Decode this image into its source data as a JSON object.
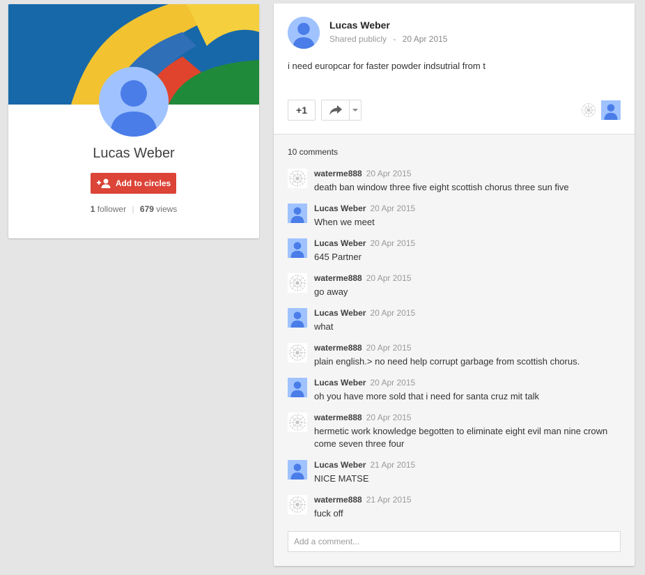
{
  "profile": {
    "name": "Lucas Weber",
    "add_button_label": "Add to circles",
    "followers_count": "1",
    "followers_label": "follower",
    "views_count": "679",
    "views_label": "views"
  },
  "post": {
    "author": "Lucas Weber",
    "visibility": "Shared publicly",
    "date": "20 Apr 2015",
    "text": "i need europcar for faster powder indsutrial from t",
    "plus_one_label": "+1",
    "comments_count_label": "10 comments",
    "add_comment_placeholder": "Add a comment..."
  },
  "comments": [
    {
      "author": "waterme888",
      "date": "20 Apr 2015",
      "text": "death ban window three five eight scottish chorus three sun five",
      "avatar": "pattern"
    },
    {
      "author": "Lucas Weber",
      "date": "20 Apr 2015",
      "text": "When we meet",
      "avatar": "user"
    },
    {
      "author": "Lucas Weber",
      "date": "20 Apr 2015",
      "text": "645 Partner",
      "avatar": "user"
    },
    {
      "author": "waterme888",
      "date": "20 Apr 2015",
      "text": "go away",
      "avatar": "pattern"
    },
    {
      "author": "Lucas Weber",
      "date": "20 Apr 2015",
      "text": "what",
      "avatar": "user"
    },
    {
      "author": "waterme888",
      "date": "20 Apr 2015",
      "text": "plain english.> no need help corrupt garbage from scottish chorus.",
      "avatar": "pattern"
    },
    {
      "author": "Lucas Weber",
      "date": "20 Apr 2015",
      "text": "oh you have more sold that i need for santa cruz mit talk",
      "avatar": "user"
    },
    {
      "author": "waterme888",
      "date": "20 Apr 2015",
      "text": "hermetic work knowledge begotten to eliminate eight evil man nine crown come seven three four",
      "avatar": "pattern"
    },
    {
      "author": "Lucas Weber",
      "date": "21 Apr 2015",
      "text": "NICE MATSE",
      "avatar": "user"
    },
    {
      "author": "waterme888",
      "date": "21 Apr 2015",
      "text": "fuck off",
      "avatar": "pattern"
    }
  ],
  "icons": {
    "add_person": "person-add-icon",
    "share": "share-arrow-icon",
    "dropdown": "dropdown-arrow-icon",
    "default_avatar": "person-silhouette-icon",
    "pattern_avatar": "pattern-avatar-icon"
  },
  "colors": {
    "accent_red": "#db4437",
    "avatar_bg": "#a0c3ff",
    "avatar_fg": "#4a7de8"
  }
}
